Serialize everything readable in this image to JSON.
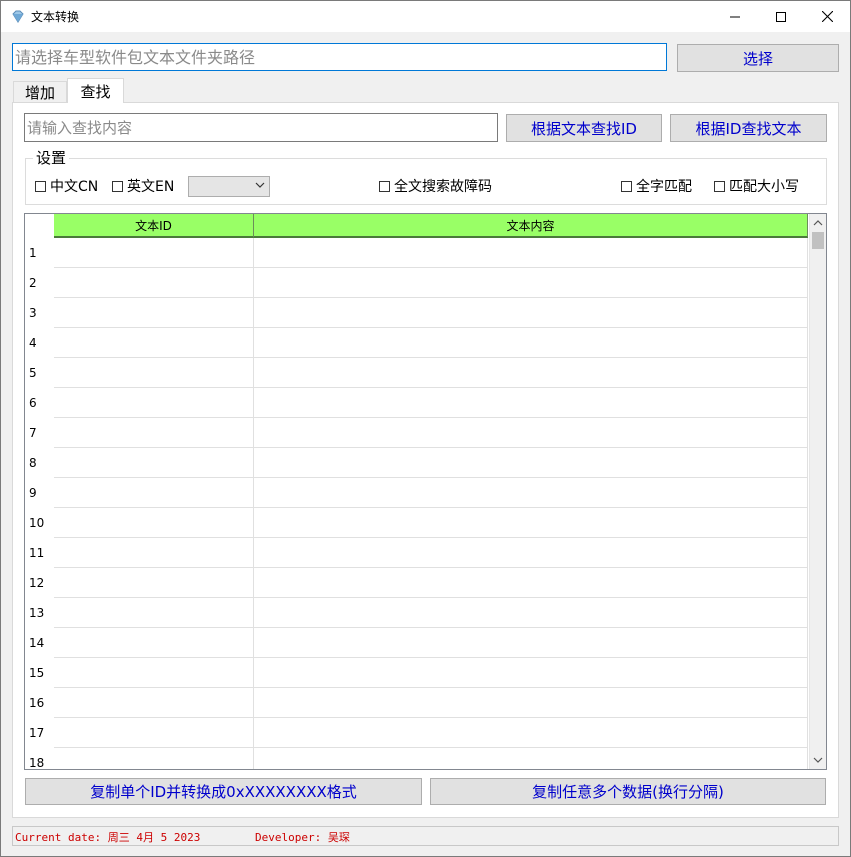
{
  "window": {
    "title": "文本转换",
    "icon": "app-gem-icon",
    "controls": [
      "minimize-icon",
      "maximize-icon",
      "close-icon"
    ]
  },
  "path": {
    "placeholder": "请选择车型软件包文本文件夹路径",
    "value": "",
    "select_button": "选择"
  },
  "tabs": [
    {
      "label": "增加",
      "active": false
    },
    {
      "label": "查找",
      "active": true
    }
  ],
  "search": {
    "placeholder": "请输入查找内容",
    "value": "",
    "by_text_button": "根据文本查找ID",
    "by_id_button": "根据ID查找文本"
  },
  "settings": {
    "label": "设置",
    "chinese_label": "中文CN",
    "chinese_checked": false,
    "english_label": "英文EN",
    "english_checked": false,
    "combo_value": "",
    "fulltext_label": "全文搜索故障码",
    "fulltext_checked": false,
    "whole_word_label": "全字匹配",
    "whole_word_checked": false,
    "match_case_label": "匹配大小写",
    "match_case_checked": false
  },
  "table": {
    "columns": [
      "文本ID",
      "文本内容"
    ],
    "header_color": "#99ff66",
    "rows": [
      {
        "n": "1",
        "id": "",
        "content": ""
      },
      {
        "n": "2",
        "id": "",
        "content": ""
      },
      {
        "n": "3",
        "id": "",
        "content": ""
      },
      {
        "n": "4",
        "id": "",
        "content": ""
      },
      {
        "n": "5",
        "id": "",
        "content": ""
      },
      {
        "n": "6",
        "id": "",
        "content": ""
      },
      {
        "n": "7",
        "id": "",
        "content": ""
      },
      {
        "n": "8",
        "id": "",
        "content": ""
      },
      {
        "n": "9",
        "id": "",
        "content": ""
      },
      {
        "n": "10",
        "id": "",
        "content": ""
      },
      {
        "n": "11",
        "id": "",
        "content": ""
      },
      {
        "n": "12",
        "id": "",
        "content": ""
      },
      {
        "n": "13",
        "id": "",
        "content": ""
      },
      {
        "n": "14",
        "id": "",
        "content": ""
      },
      {
        "n": "15",
        "id": "",
        "content": ""
      },
      {
        "n": "16",
        "id": "",
        "content": ""
      },
      {
        "n": "17",
        "id": "",
        "content": ""
      },
      {
        "n": "18",
        "id": "",
        "content": ""
      }
    ]
  },
  "actions": {
    "copy_id_button": "复制单个ID并转换成0xXXXXXXXX格式",
    "copy_multi_button": "复制任意多个数据(换行分隔)"
  },
  "status": {
    "date": "Current date: 周三 4月 5 2023",
    "developer": "Developer: 吴琛",
    "color": "#cc0000"
  },
  "colors": {
    "button_text": "#0000cc",
    "focus_border": "#0078d7"
  }
}
